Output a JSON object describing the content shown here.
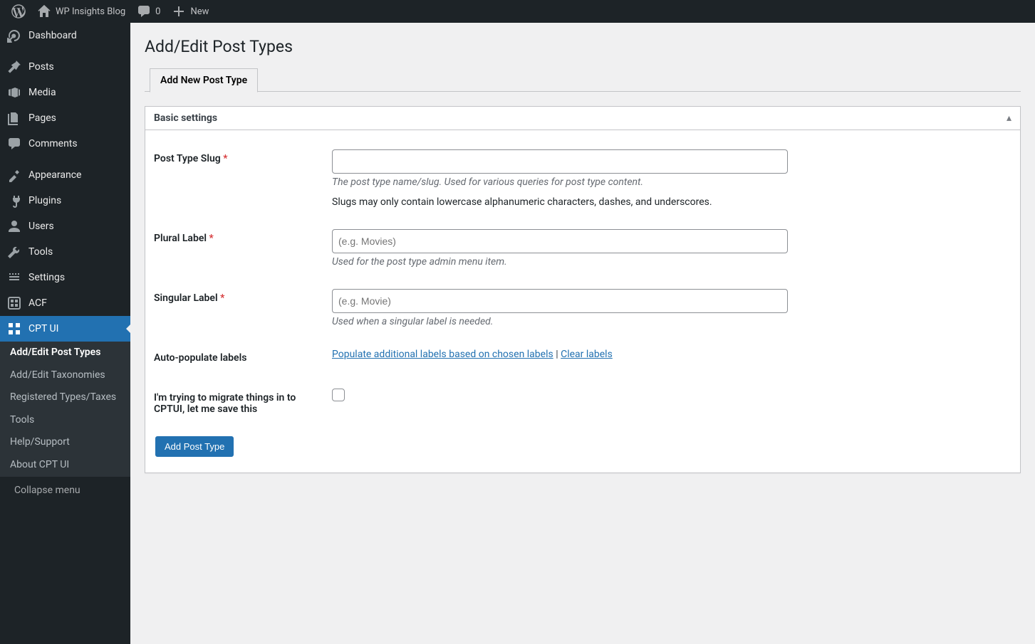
{
  "adminbar": {
    "site_title": "WP Insights Blog",
    "comments_count": "0",
    "new_label": "New"
  },
  "sidebar": {
    "items": [
      {
        "icon": "dashboard",
        "label": "Dashboard"
      },
      {
        "sep": true
      },
      {
        "icon": "pin",
        "label": "Posts"
      },
      {
        "icon": "media",
        "label": "Media"
      },
      {
        "icon": "pages",
        "label": "Pages"
      },
      {
        "icon": "comments",
        "label": "Comments"
      },
      {
        "sep": true
      },
      {
        "icon": "appearance",
        "label": "Appearance"
      },
      {
        "icon": "plugins",
        "label": "Plugins"
      },
      {
        "icon": "users",
        "label": "Users"
      },
      {
        "icon": "tools",
        "label": "Tools"
      },
      {
        "icon": "settings",
        "label": "Settings"
      },
      {
        "icon": "acf",
        "label": "ACF"
      },
      {
        "icon": "cptui",
        "label": "CPT UI",
        "current": true
      }
    ],
    "submenu": [
      {
        "label": "Add/Edit Post Types",
        "current": true
      },
      {
        "label": "Add/Edit Taxonomies"
      },
      {
        "label": "Registered Types/Taxes"
      },
      {
        "label": "Tools"
      },
      {
        "label": "Help/Support"
      },
      {
        "label": "About CPT UI"
      }
    ],
    "collapse_label": "Collapse menu"
  },
  "page": {
    "title": "Add/Edit Post Types",
    "tab_label": "Add New Post Type"
  },
  "panel": {
    "title": "Basic settings",
    "fields": {
      "slug": {
        "label": "Post Type Slug",
        "desc": "The post type name/slug. Used for various queries for post type content.",
        "note": "Slugs may only contain lowercase alphanumeric characters, dashes, and underscores."
      },
      "plural": {
        "label": "Plural Label",
        "placeholder": "(e.g. Movies)",
        "desc": "Used for the post type admin menu item."
      },
      "singular": {
        "label": "Singular Label",
        "placeholder": "(e.g. Movie)",
        "desc": "Used when a singular label is needed."
      },
      "auto": {
        "label": "Auto-populate labels",
        "link1": "Populate additional labels based on chosen labels",
        "sep": " | ",
        "link2": "Clear labels"
      },
      "migrate": {
        "label": "I'm trying to migrate things in to CPTUI, let me save this"
      }
    },
    "submit_label": "Add Post Type"
  }
}
